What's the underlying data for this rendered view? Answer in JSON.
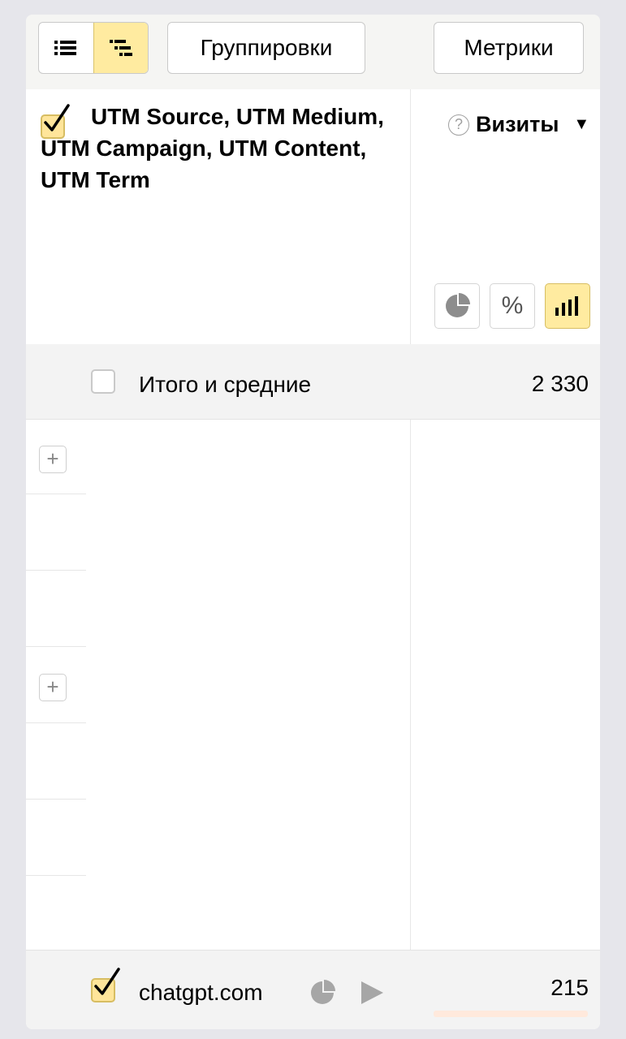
{
  "toolbar": {
    "view_list_icon": "list-icon",
    "view_tree_icon": "tree-icon",
    "groupings_label": "Группировки",
    "metrics_label": "Метрики"
  },
  "header": {
    "dimension_title": "UTM Source, UTM Medium, UTM Campaign, UTM Content, UTM Term",
    "metric_title": "Визиты",
    "help_icon": "?",
    "sort_icon": "▼",
    "metric_buttons": [
      "pie-chart-icon",
      "percent-icon",
      "bar-chart-icon"
    ],
    "percent_symbol": "%"
  },
  "totals": {
    "label": "Итого и средние",
    "value": "2 330"
  },
  "rows": [
    {
      "label": "chatgpt.com",
      "value": "215",
      "checked": true
    }
  ],
  "colors": {
    "accent_yellow": "#ffeba0",
    "background": "#e6e6eb",
    "row_bar": "#ffe9dc"
  }
}
